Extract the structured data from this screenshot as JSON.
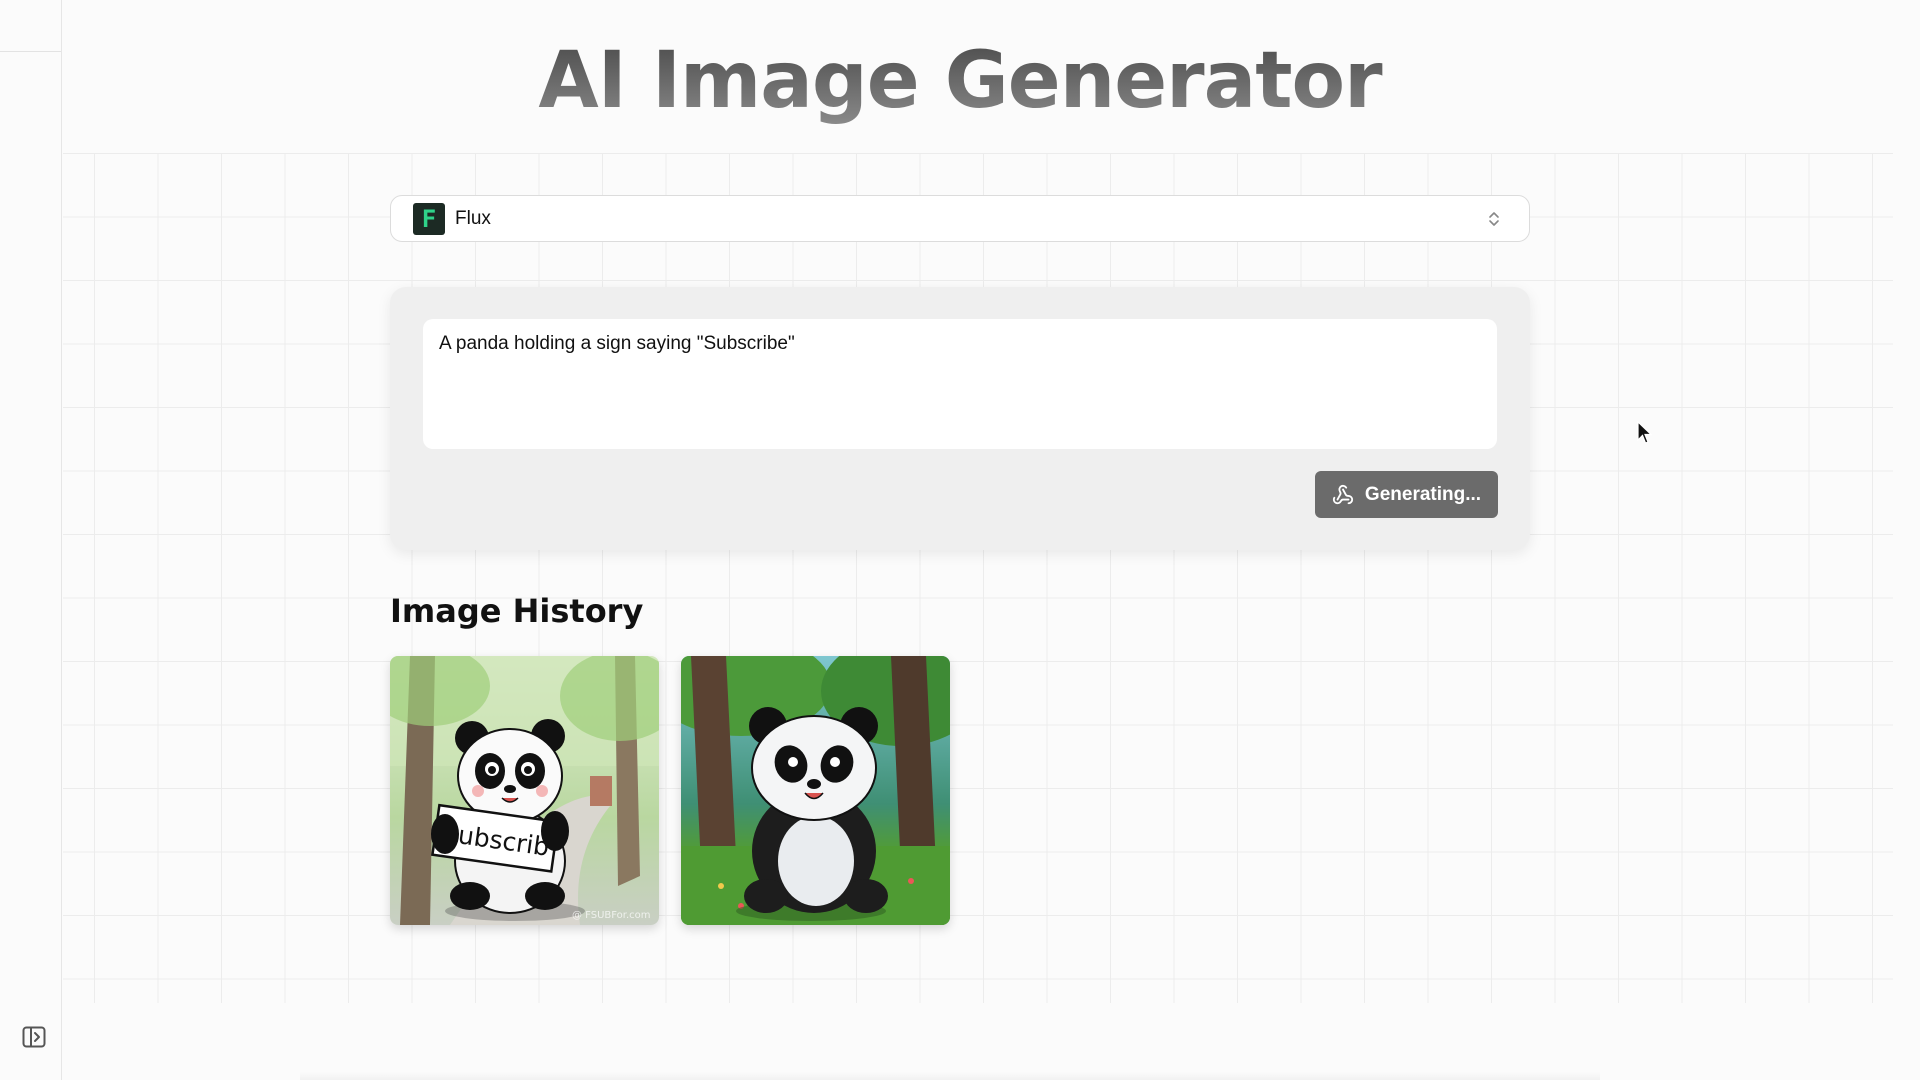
{
  "header": {
    "title": "AI Image Generator"
  },
  "model_select": {
    "selected": "Flux",
    "logo_letter": "F",
    "logo_color": "#2fd38a"
  },
  "prompt": {
    "value": "A panda holding a sign saying \"Subscribe\""
  },
  "generate_button": {
    "label": "Generating..."
  },
  "history": {
    "title": "Image History",
    "items": [
      {
        "description": "panda-holding-subscribe-sign",
        "sign_text": "Subscrib",
        "watermark": "@ FSUBFor.com"
      },
      {
        "description": "panda-sitting-in-forest"
      }
    ]
  },
  "colors": {
    "button_bg": "#6b6b6b",
    "card_bg": "#efefef",
    "page_bg": "#fbfbfb"
  }
}
